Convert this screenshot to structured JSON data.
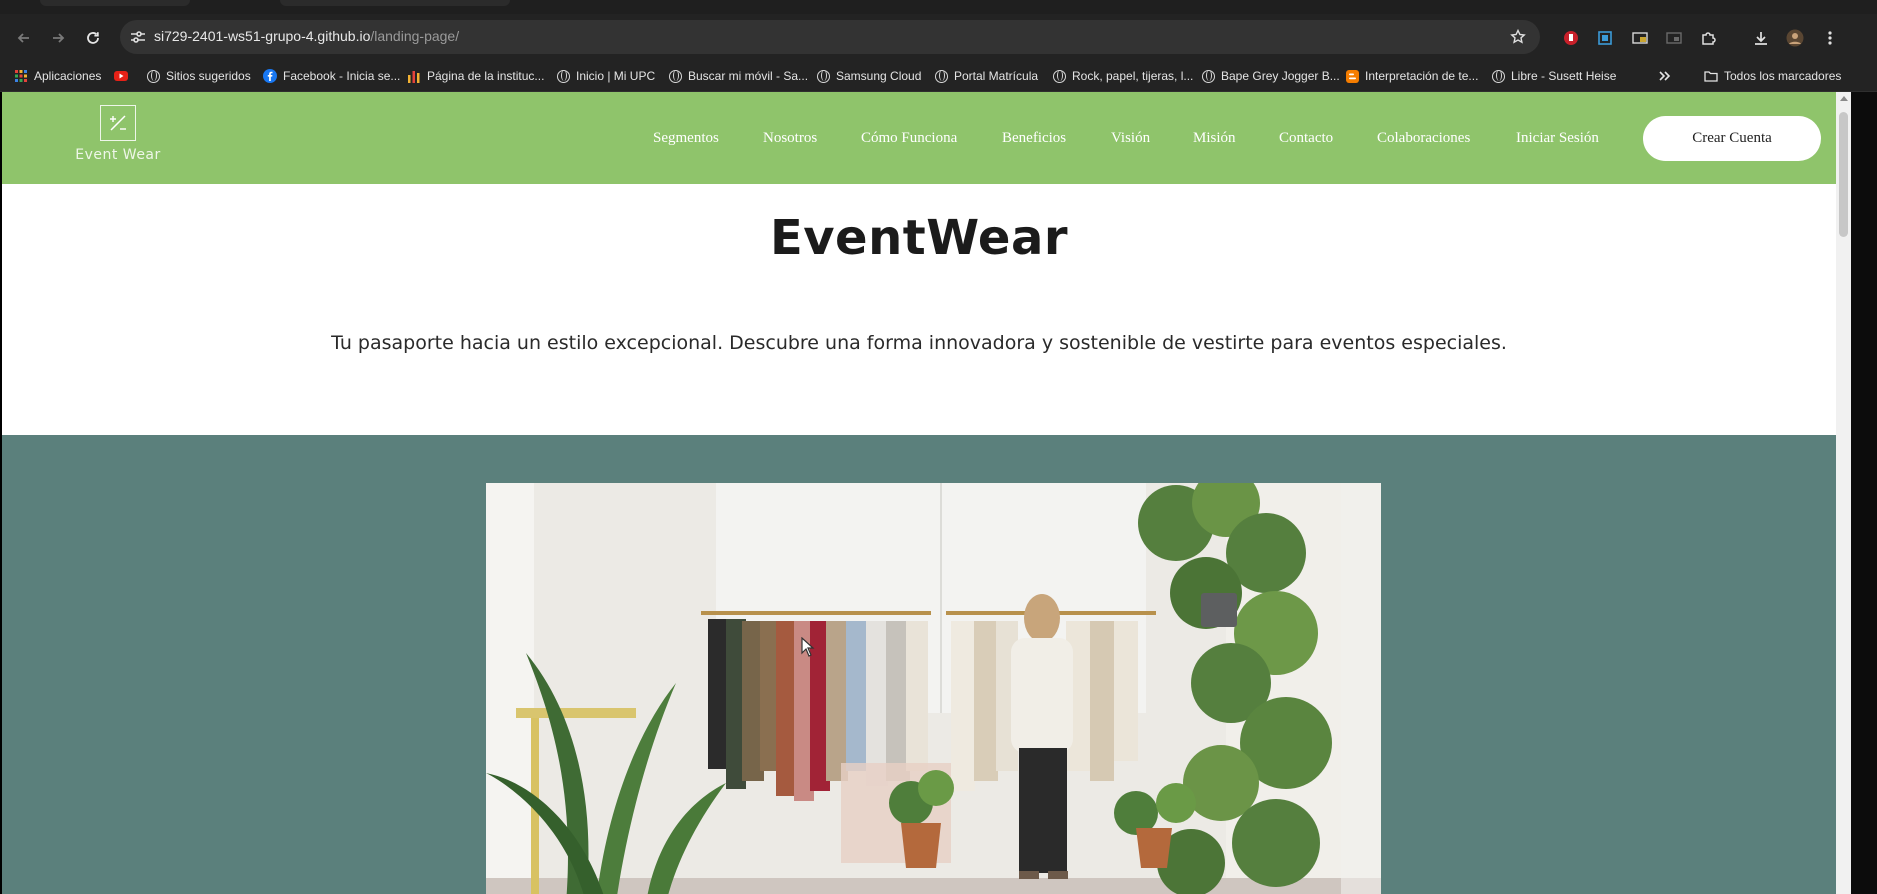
{
  "browser": {
    "url_host": "si729-2401-ws51-grupo-4.github.io",
    "url_path": "/landing-page/",
    "bookmarks": [
      {
        "label": "Aplicaciones",
        "icon": "apps-grid-icon"
      },
      {
        "label": "",
        "icon": "youtube-icon"
      },
      {
        "label": "Sitios sugeridos",
        "icon": "globe-icon"
      },
      {
        "label": "Facebook - Inicia se...",
        "icon": "facebook-icon"
      },
      {
        "label": "Página de la instituc...",
        "icon": "bar-chart-icon"
      },
      {
        "label": "Inicio | Mi UPC",
        "icon": "globe-icon"
      },
      {
        "label": "Buscar mi móvil - Sa...",
        "icon": "globe-icon"
      },
      {
        "label": "Samsung Cloud",
        "icon": "globe-icon"
      },
      {
        "label": "Portal Matrícula",
        "icon": "globe-icon"
      },
      {
        "label": "Rock, papel, tijeras, l...",
        "icon": "globe-icon"
      },
      {
        "label": "Bape Grey Jogger B...",
        "icon": "globe-icon"
      },
      {
        "label": "Interpretación de te...",
        "icon": "blogger-icon"
      },
      {
        "label": "Libre - Susett Heise",
        "icon": "globe-icon"
      }
    ],
    "all_bookmarks_label": "Todos los marcadores"
  },
  "page": {
    "logo_text": "Event Wear",
    "nav": [
      "Segmentos",
      "Nosotros",
      "Cómo Funciona",
      "Beneficios",
      "Visión",
      "Misión",
      "Contacto",
      "Colaboraciones",
      "Iniciar Sesión"
    ],
    "cta_label": "Crear Cuenta",
    "hero_title": "EventWear",
    "hero_subtitle": "Tu pasaporte hacia un estilo excepcional. Descubre una forma innovadora y sostenible de vestirte para eventos especiales."
  },
  "colors": {
    "header_green": "#8fc46b",
    "band_teal": "#5b807c",
    "chrome_dark": "#232323"
  }
}
